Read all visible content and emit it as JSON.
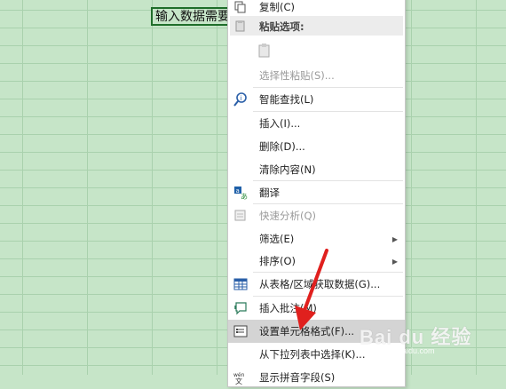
{
  "cell": {
    "text": "输入数据需要"
  },
  "menu": {
    "copy": "复制(C)",
    "paste_options": "粘贴选项:",
    "paste_special": "选择性粘贴(S)...",
    "smart_lookup": "智能查找(L)",
    "insert": "插入(I)...",
    "delete": "删除(D)...",
    "clear_contents": "清除内容(N)",
    "translate": "翻译",
    "quick_analysis": "快速分析(Q)",
    "filter": "筛选(E)",
    "sort": "排序(O)",
    "get_data_from_table": "从表格/区域获取数据(G)...",
    "insert_comment": "插入批注(M)",
    "format_cells": "设置单元格格式(F)...",
    "pick_from_dropdown": "从下拉列表中选择(K)...",
    "show_phonetic": "显示拼音字段(S)"
  },
  "icons": {
    "copy": "copy-icon",
    "paste": "paste-icon",
    "smart_lookup": "smart-lookup-icon",
    "translate": "translate-icon",
    "quick_analysis": "quick-analysis-icon",
    "table": "table-icon",
    "comment": "comment-icon",
    "format": "format-cells-icon",
    "phonetic": "phonetic-icon"
  },
  "watermark": {
    "logo": "Bai du 经验",
    "url": "jingyan.baidu.com"
  },
  "colors": {
    "sheet": "#c6e5c8",
    "highlight": "#d4d4d4",
    "arrow": "#e0201e"
  }
}
